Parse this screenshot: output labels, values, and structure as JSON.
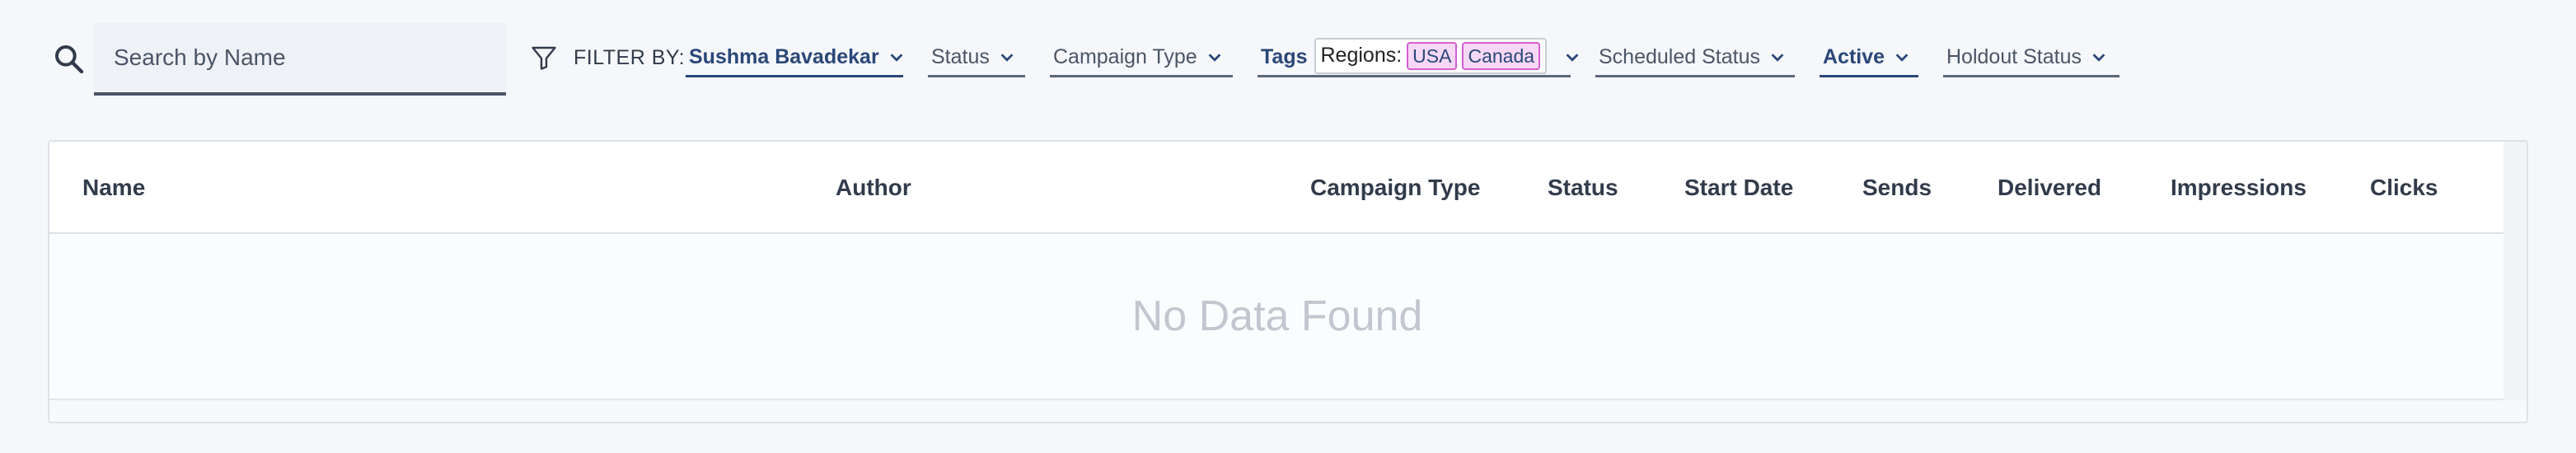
{
  "search": {
    "placeholder": "Search by Name"
  },
  "filters": {
    "label": "FILTER BY:",
    "author": "Sushma Bavadekar",
    "status": "Status",
    "campaign_type": "Campaign Type",
    "tags": {
      "label": "Tags",
      "regions_label": "Regions:",
      "values": [
        "USA",
        "Canada"
      ]
    },
    "scheduled_status": "Scheduled Status",
    "active": "Active",
    "holdout_status": "Holdout Status"
  },
  "table": {
    "columns": [
      "Name",
      "Author",
      "Campaign Type",
      "Status",
      "Start Date",
      "Sends",
      "Delivered",
      "Impressions",
      "Clicks"
    ],
    "empty_message": "No Data Found"
  },
  "colors": {
    "accent": "#2a4778",
    "tag_border": "#d45fd4",
    "tag_bg": "#f6d8f6"
  },
  "icons": [
    "search-icon",
    "filter-icon",
    "chevron-down-icon"
  ]
}
